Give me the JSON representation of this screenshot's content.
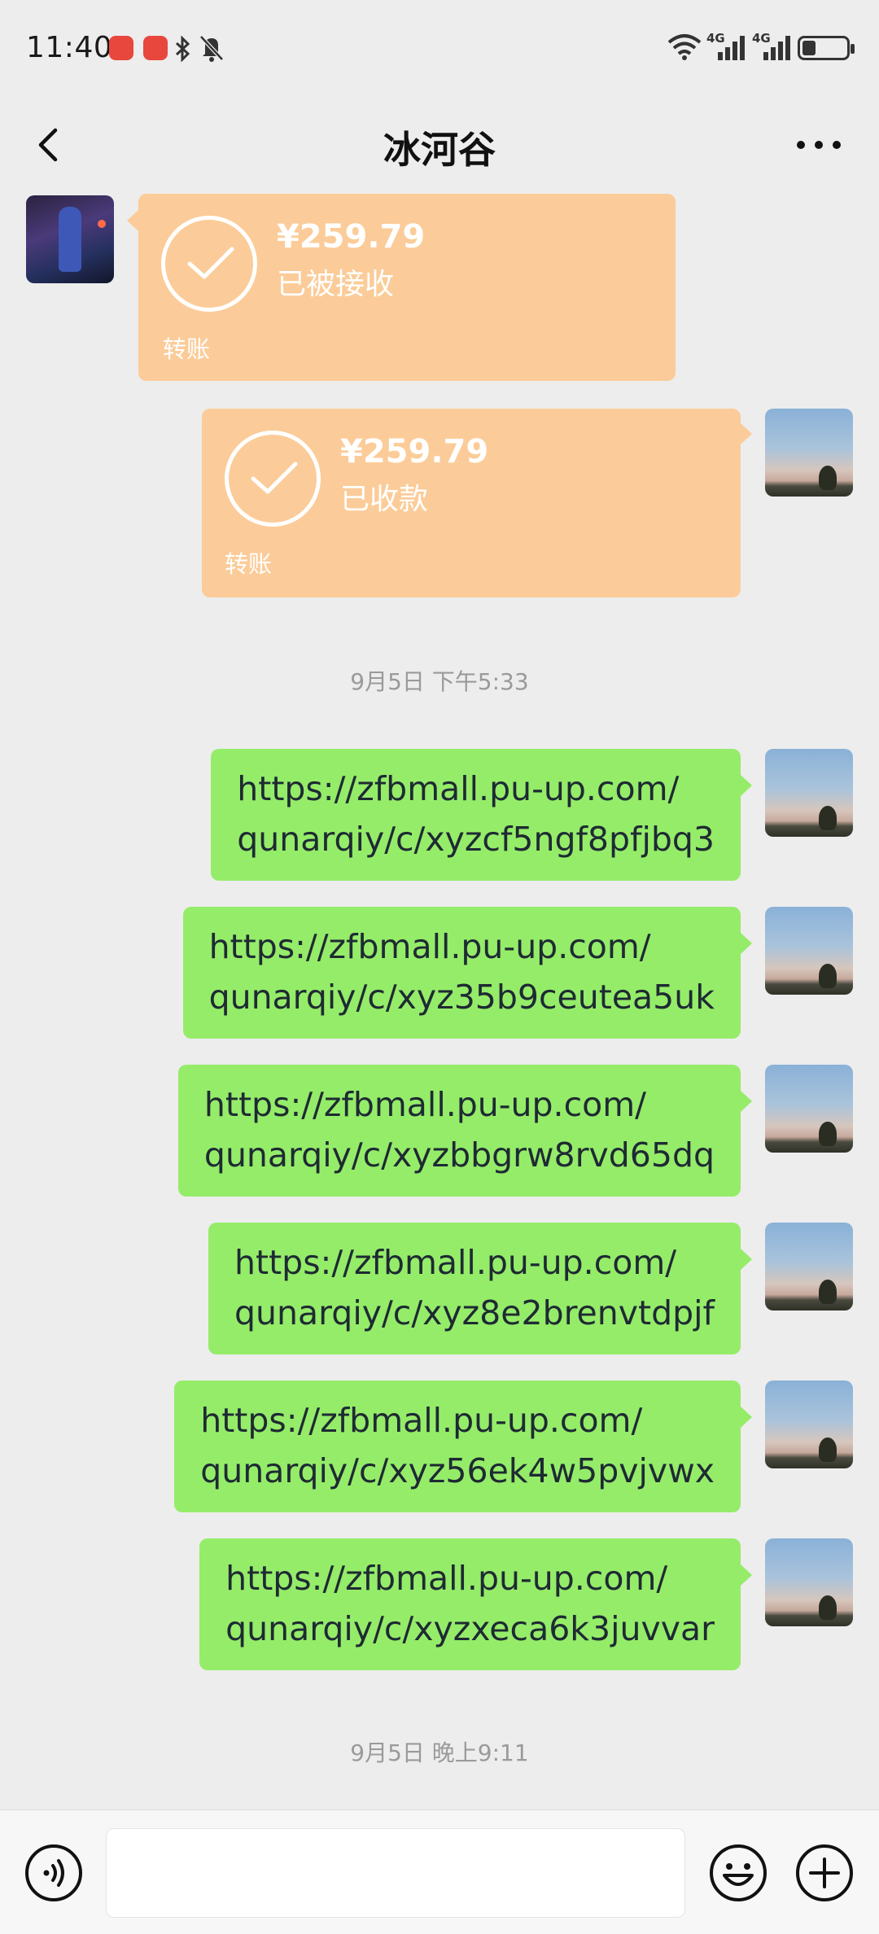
{
  "status_bar": {
    "time": "11:40",
    "network_1": "4G",
    "network_2": "4G"
  },
  "header": {
    "title": "冰河谷"
  },
  "messages": {
    "transfer_in": {
      "amount": "¥259.79",
      "status": "已被接收",
      "label": "转账"
    },
    "transfer_out": {
      "amount": "¥259.79",
      "status": "已收款",
      "label": "转账"
    },
    "timestamp_1": "9月5日 下午5:33",
    "links": [
      {
        "line1": "https://zfbmall.pu-up.com/",
        "line2": "qunarqiy/c/xyzcf5ngf8pfjbq3"
      },
      {
        "line1": "https://zfbmall.pu-up.com/",
        "line2": "qunarqiy/c/xyz35b9ceutea5uk"
      },
      {
        "line1": "https://zfbmall.pu-up.com/",
        "line2": "qunarqiy/c/xyzbbgrw8rvd65dq"
      },
      {
        "line1": "https://zfbmall.pu-up.com/",
        "line2": "qunarqiy/c/xyz8e2brenvtdpjf"
      },
      {
        "line1": "https://zfbmall.pu-up.com/",
        "line2": "qunarqiy/c/xyz56ek4w5pvjvwx"
      },
      {
        "line1": "https://zfbmall.pu-up.com/",
        "line2": "qunarqiy/c/xyzxeca6k3juvvar"
      }
    ],
    "timestamp_2": "9月5日 晚上9:11"
  },
  "input_bar": {
    "value": ""
  },
  "colors": {
    "background": "#ededed",
    "transfer_bubble": "#fbcc99",
    "text_bubble": "#95ec69"
  }
}
